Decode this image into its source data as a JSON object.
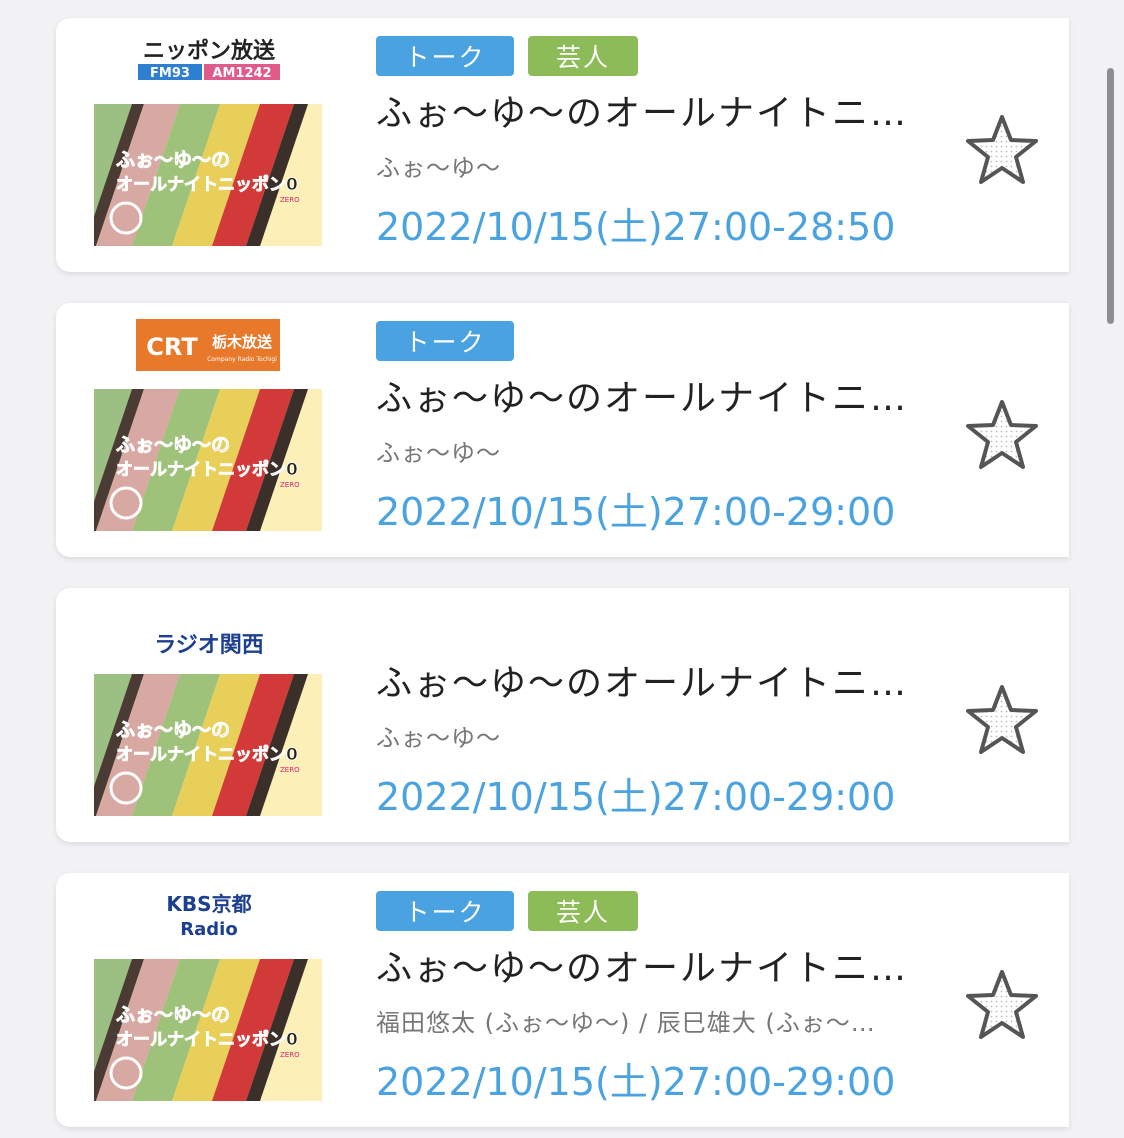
{
  "programs": [
    {
      "station": {
        "name_line1": "ニッポン放送",
        "badge_fm": "FM93",
        "badge_am": "AM1242",
        "icon": "nippon-broadcasting-logo"
      },
      "thumbnail": {
        "line1": "ふぉ〜ゆ〜の",
        "line2": "オールナイトニッポン0",
        "tag": "ZERO"
      },
      "tags": [
        {
          "label": "トーク",
          "color": "#4aa3e0"
        },
        {
          "label": "芸人",
          "color": "#8dbb58"
        }
      ],
      "title": "ふぉ〜ゆ〜のオールナイトニ…",
      "performers": "ふぉ〜ゆ〜",
      "airtime": "2022/10/15(土)27:00-28:50",
      "favorite_icon": "star-outline-icon"
    },
    {
      "station": {
        "name_line1": "CRT",
        "name_kanji": "栃木放送",
        "sub": "Company Radio Tochigi",
        "icon": "crt-tochigi-logo"
      },
      "thumbnail": {
        "line1": "ふぉ〜ゆ〜の",
        "line2": "オールナイトニッポン0",
        "tag": "ZERO"
      },
      "tags": [
        {
          "label": "トーク",
          "color": "#4aa3e0"
        }
      ],
      "title": "ふぉ〜ゆ〜のオールナイトニ…",
      "performers": "ふぉ〜ゆ〜",
      "airtime": "2022/10/15(土)27:00-29:00",
      "favorite_icon": "star-outline-icon"
    },
    {
      "station": {
        "name_line1": "ラジオ関西",
        "icon": "radio-kansai-logo"
      },
      "thumbnail": {
        "line1": "ふぉ〜ゆ〜の",
        "line2": "オールナイトニッポン0",
        "tag": "ZERO"
      },
      "tags": [],
      "title": "ふぉ〜ゆ〜のオールナイトニ…",
      "performers": "ふぉ〜ゆ〜",
      "airtime": "2022/10/15(土)27:00-29:00",
      "favorite_icon": "star-outline-icon"
    },
    {
      "station": {
        "name_line1": "KBS京都",
        "name_line2": "Radio",
        "icon": "kbs-kyoto-logo"
      },
      "thumbnail": {
        "line1": "ふぉ〜ゆ〜の",
        "line2": "オールナイトニッポン0",
        "tag": "ZERO"
      },
      "tags": [
        {
          "label": "トーク",
          "color": "#4aa3e0"
        },
        {
          "label": "芸人",
          "color": "#8dbb58"
        }
      ],
      "title": "ふぉ〜ゆ〜のオールナイトニ…",
      "performers": "福田悠太 (ふぉ〜ゆ〜) / 辰巳雄大 (ふぉ〜…",
      "airtime": "2022/10/15(土)27:00-29:00",
      "favorite_icon": "star-outline-icon"
    }
  ],
  "colors": {
    "accent": "#4aa3e0",
    "tag_green": "#8dbb58",
    "background": "#f2f2f4"
  }
}
